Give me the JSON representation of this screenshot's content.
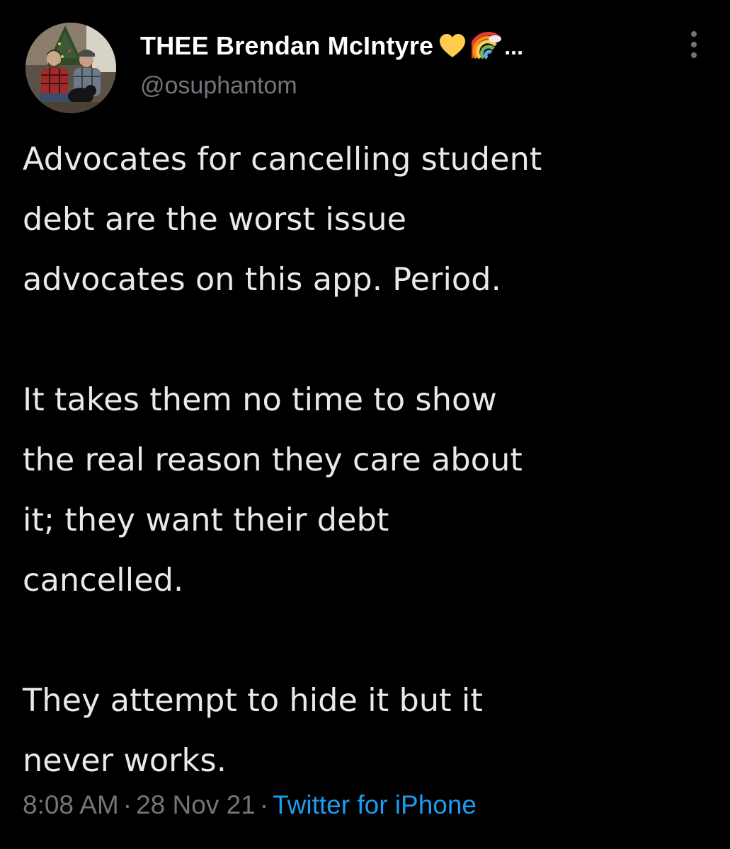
{
  "author": {
    "display_name": "THEE Brendan McIntyre",
    "name_emojis": [
      "yellow-heart-icon",
      "rainbow-icon"
    ],
    "name_truncation": "...",
    "handle": "@osuphantom",
    "avatar": "profile-photo"
  },
  "tweet": {
    "paragraphs": [
      [
        "Advocates for cancelling student",
        "debt are the worst issue",
        "advocates on this app. Period."
      ],
      [
        "It takes them no time to show",
        "the real reason they care about",
        "it; they want their debt",
        "cancelled."
      ],
      [
        "They attempt to hide it but it",
        "never works."
      ]
    ]
  },
  "meta": {
    "time": "8:08 AM",
    "separator": "·",
    "date": "28 Nov 21",
    "source": "Twitter for iPhone"
  },
  "more_button_icon": "vertical-dots-icon",
  "colors": {
    "background": "#000000",
    "text": "#e7e9ea",
    "secondary": "#71767b",
    "link": "#1d9bf0"
  }
}
